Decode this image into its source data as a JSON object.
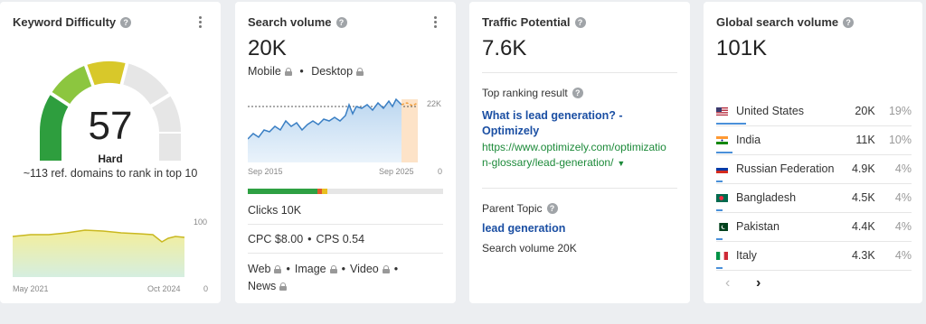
{
  "kd": {
    "title": "Keyword Difficulty",
    "score": "57",
    "label": "Hard",
    "subtitle": "~113 ref. domains to rank in top 10",
    "chart_max": "100",
    "chart_min": "0",
    "x_start": "May 2021",
    "x_end": "Oct 2024"
  },
  "sv": {
    "title": "Search volume",
    "value": "20K",
    "devices": [
      "Mobile",
      "Desktop"
    ],
    "y_max_label": "22K",
    "y_min_label": "0",
    "x_start": "Sep 2015",
    "x_end": "Sep 2025",
    "clicks": "Clicks 10K",
    "cpc": "CPC $8.00",
    "cps": "CPS 0.54",
    "serp_features": [
      "Web",
      "Image",
      "Video",
      "News"
    ]
  },
  "tp": {
    "title": "Traffic Potential",
    "value": "7.6K",
    "top_result_label": "Top ranking result",
    "top_result_title_1": "What is lead generation? -",
    "top_result_title_2": "Optimizely",
    "top_result_url_1": "https://www.optimizely.com/optimizatio",
    "top_result_url_2": "n-glossary/lead-generation/",
    "parent_topic_label": "Parent Topic",
    "parent_topic": "lead generation",
    "parent_volume": "Search volume 20K"
  },
  "gsv": {
    "title": "Global search volume",
    "value": "101K",
    "countries": [
      {
        "name": "United States",
        "volume": "20K",
        "pct": "19%",
        "share": 0.19
      },
      {
        "name": "India",
        "volume": "11K",
        "pct": "10%",
        "share": 0.1
      },
      {
        "name": "Russian Federation",
        "volume": "4.9K",
        "pct": "4%",
        "share": 0.04
      },
      {
        "name": "Bangladesh",
        "volume": "4.5K",
        "pct": "4%",
        "share": 0.04
      },
      {
        "name": "Pakistan",
        "volume": "4.4K",
        "pct": "4%",
        "share": 0.04
      },
      {
        "name": "Italy",
        "volume": "4.3K",
        "pct": "4%",
        "share": 0.04
      }
    ]
  },
  "colors": {
    "gauge_green_dark": "#2e9e3e",
    "gauge_green": "#8cc63f",
    "gauge_yellow": "#d8c82a",
    "gauge_grey": "#e6e6e6",
    "line_blue": "#3a7fc4",
    "forecast_orange": "#f0a040",
    "bar_green": "#2ea043",
    "bar_red": "#e05a2b",
    "bar_yellow": "#e8c020"
  }
}
